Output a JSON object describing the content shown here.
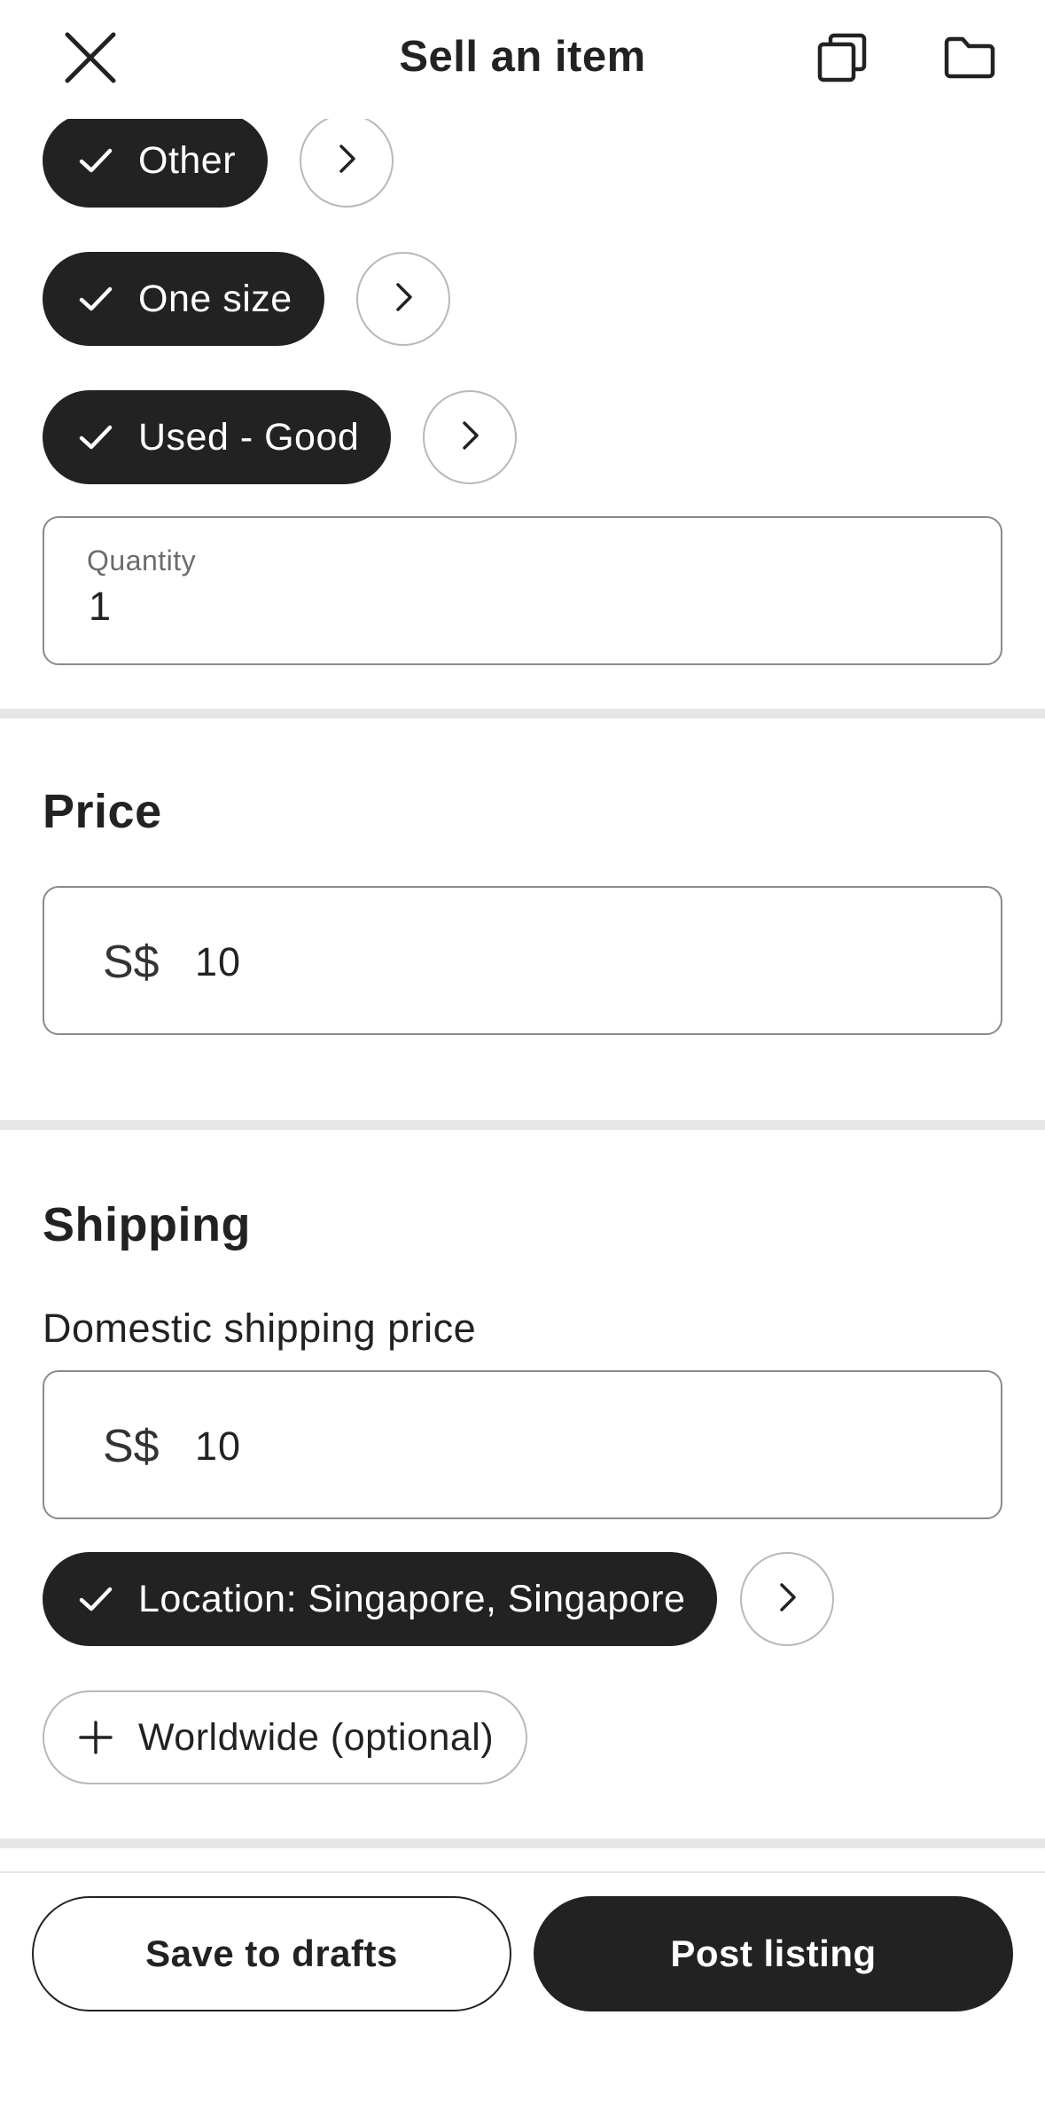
{
  "header": {
    "title": "Sell an item",
    "icons": [
      "close-icon",
      "copy-icon",
      "folder-icon"
    ]
  },
  "chips": {
    "category": "Other",
    "size": "One size",
    "condition": "Used - Good"
  },
  "quantity": {
    "label": "Quantity",
    "value": "1"
  },
  "price": {
    "section_title": "Price",
    "currency": "S$",
    "value": "10"
  },
  "shipping": {
    "section_title": "Shipping",
    "domestic_label": "Domestic shipping price",
    "currency": "S$",
    "value": "10",
    "location_chip": "Location: Singapore, Singapore",
    "worldwide_chip": "Worldwide (optional)"
  },
  "footer": {
    "save_label": "Save to drafts",
    "post_label": "Post listing"
  },
  "colors": {
    "dark": "#222222",
    "border": "#8a8a8a",
    "divider": "#e6e6e6"
  }
}
